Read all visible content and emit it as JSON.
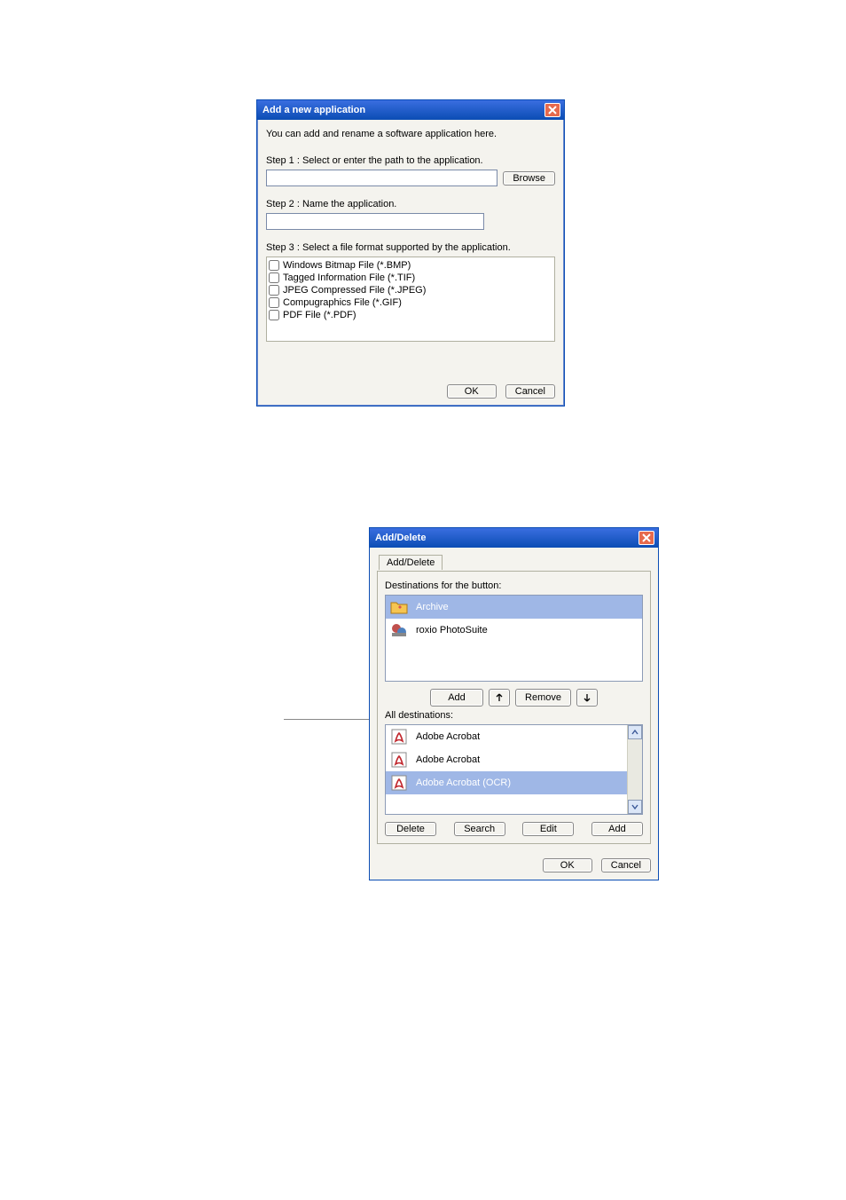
{
  "dialog1": {
    "title": "Add a new application",
    "intro": "You can add and rename a software application here.",
    "step1": "Step 1 : Select or enter the path to the application.",
    "path_value": "",
    "browse": "Browse",
    "step2": "Step 2 : Name the application.",
    "name_value": "",
    "step3": "Step 3 : Select a file format supported by the application.",
    "formats": [
      "Windows Bitmap File (*.BMP)",
      "Tagged Information File (*.TIF)",
      "JPEG Compressed File (*.JPEG)",
      "Compugraphics File (*.GIF)",
      "PDF File (*.PDF)"
    ],
    "ok": "OK",
    "cancel": "Cancel"
  },
  "dialog2": {
    "title": "Add/Delete",
    "tab": "Add/Delete",
    "dest_caption": "Destinations for the button:",
    "dest_items": [
      {
        "label": "Archive",
        "selected": true,
        "icon": "folder"
      },
      {
        "label": "roxio PhotoSuite",
        "selected": false,
        "icon": "app"
      }
    ],
    "btn_add": "Add",
    "btn_remove": "Remove",
    "all_caption": "All destinations:",
    "all_items": [
      {
        "label": "Adobe Acrobat",
        "selected": false,
        "icon": "acrobat"
      },
      {
        "label": "Adobe Acrobat",
        "selected": false,
        "icon": "acrobat"
      },
      {
        "label": "Adobe Acrobat (OCR)",
        "selected": true,
        "icon": "acrobat"
      }
    ],
    "btn_delete": "Delete",
    "btn_search": "Search",
    "btn_edit": "Edit",
    "btn_add2": "Add",
    "ok": "OK",
    "cancel": "Cancel"
  }
}
